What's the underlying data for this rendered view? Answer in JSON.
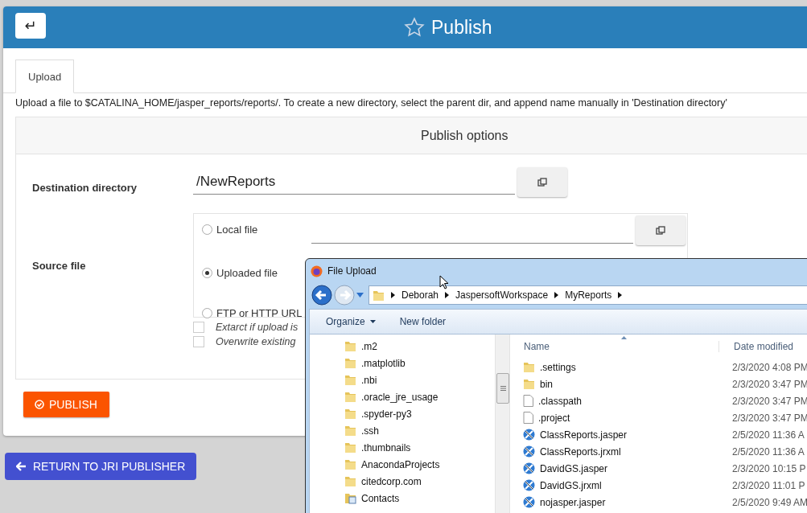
{
  "header": {
    "back_button": "↵",
    "title": "Publish"
  },
  "tabs": [
    {
      "label": "Upload",
      "selected": true
    }
  ],
  "info": "Upload a file to $CATALINA_HOME/jasper_reports/reports/. To create a new directory, select the parent dir, and append name manually in 'Destination directory'",
  "publish_options": {
    "title": "Publish options",
    "destination": {
      "label": "Destination directory",
      "value": "/NewReports"
    },
    "source": {
      "label": "Source file",
      "options": [
        {
          "label": "Local file",
          "selected": false,
          "kind": "file"
        },
        {
          "label": "Uploaded file",
          "selected": true,
          "kind": "plain"
        },
        {
          "label": "FTP or HTTP URL",
          "selected": false,
          "kind": "plain"
        }
      ]
    },
    "checkboxes": [
      {
        "label": "Extarct if upload is",
        "checked": false
      },
      {
        "label": "Overwrite existing",
        "checked": false
      }
    ]
  },
  "publish_button": "PUBLISH",
  "return_button": "RETURN TO JRI PUBLISHER",
  "dialog": {
    "title": "File Upload",
    "breadcrumb": [
      "Deborah",
      "JaspersoftWorkspace",
      "MyReports"
    ],
    "toolbar": [
      {
        "label": "Organize",
        "kind": "menu"
      },
      {
        "label": "New folder",
        "kind": "plain"
      }
    ],
    "nav_tree": [
      {
        "label": ".m2",
        "kind": "folder"
      },
      {
        "label": ".matplotlib",
        "kind": "folder"
      },
      {
        "label": ".nbi",
        "kind": "folder"
      },
      {
        "label": ".oracle_jre_usage",
        "kind": "folder"
      },
      {
        "label": ".spyder-py3",
        "kind": "folder"
      },
      {
        "label": ".ssh",
        "kind": "folder"
      },
      {
        "label": ".thumbnails",
        "kind": "folder"
      },
      {
        "label": "AnacondaProjects",
        "kind": "folder"
      },
      {
        "label": "citedcorp.com",
        "kind": "folder"
      },
      {
        "label": "Contacts",
        "kind": "contacts"
      }
    ],
    "columns": [
      "Name",
      "Date modified"
    ],
    "files": [
      {
        "name": ".settings",
        "date": "2/3/2020 4:08 PM",
        "kind": "folder"
      },
      {
        "name": "bin",
        "date": "2/3/2020 3:47 PM",
        "kind": "folder"
      },
      {
        "name": ".classpath",
        "date": "2/3/2020 3:47 PM",
        "kind": "file"
      },
      {
        "name": ".project",
        "date": "2/3/2020 3:47 PM",
        "kind": "file"
      },
      {
        "name": "ClassReports.jasper",
        "date": "2/5/2020 11:36 A",
        "kind": "jasper"
      },
      {
        "name": "ClassReports.jrxml",
        "date": "2/5/2020 11:36 A",
        "kind": "jasper"
      },
      {
        "name": "DavidGS.jasper",
        "date": "2/3/2020 10:15 P",
        "kind": "jasper"
      },
      {
        "name": "DavidGS.jrxml",
        "date": "2/3/2020 11:01 P",
        "kind": "jasper"
      },
      {
        "name": "nojasper.jasper",
        "date": "2/5/2020 9:49 AM",
        "kind": "jasper"
      }
    ]
  }
}
